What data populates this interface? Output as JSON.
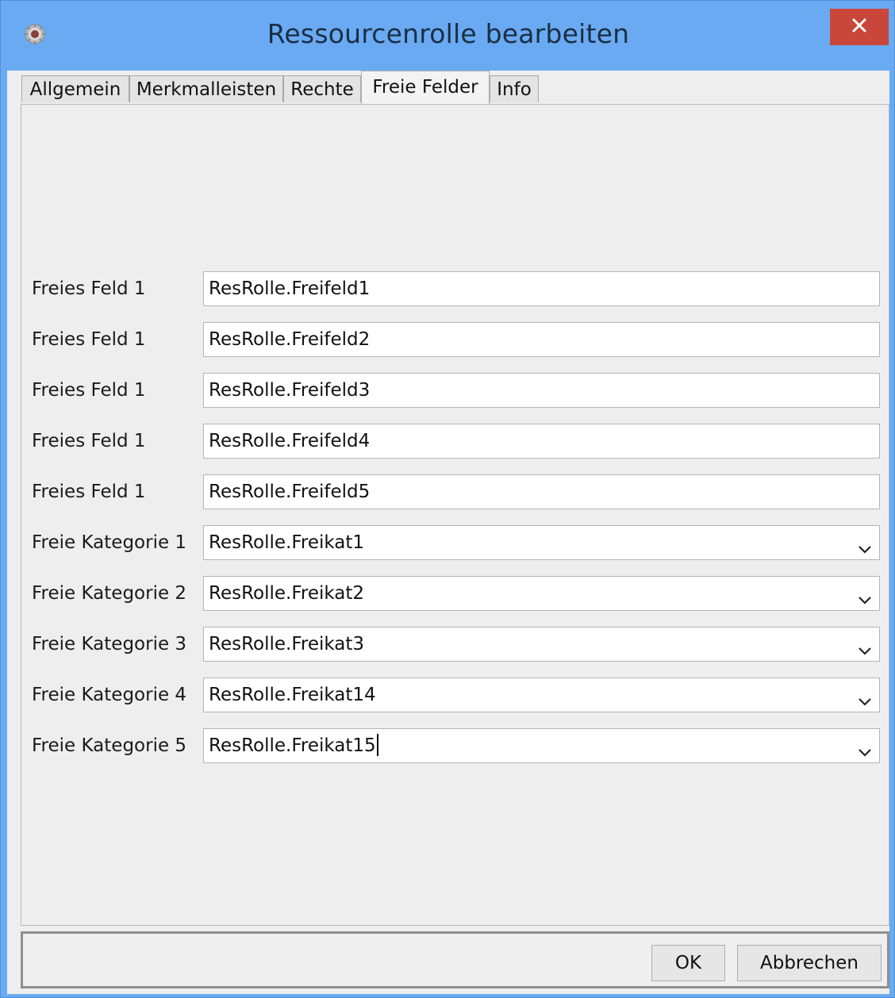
{
  "window": {
    "title": "Ressourcenrolle bearbeiten",
    "icon": "gear-globe-icon",
    "close_icon": "close-icon"
  },
  "tabs": [
    {
      "label": "Allgemein",
      "active": false
    },
    {
      "label": "Merkmalleisten",
      "active": false
    },
    {
      "label": "Rechte",
      "active": false
    },
    {
      "label": "Freie Felder",
      "active": true
    },
    {
      "label": "Info",
      "active": false
    }
  ],
  "free_fields": [
    {
      "label": "Freies Feld 1",
      "value": "ResRolle.Freifeld1"
    },
    {
      "label": "Freies Feld 1",
      "value": "ResRolle.Freifeld2"
    },
    {
      "label": "Freies Feld 1",
      "value": "ResRolle.Freifeld3"
    },
    {
      "label": "Freies Feld 1",
      "value": "ResRolle.Freifeld4"
    },
    {
      "label": "Freies Feld 1",
      "value": "ResRolle.Freifeld5"
    }
  ],
  "free_categories": [
    {
      "label": "Freie Kategorie 1",
      "value": "ResRolle.Freikat1"
    },
    {
      "label": "Freie Kategorie 2",
      "value": "ResRolle.Freikat2"
    },
    {
      "label": "Freie Kategorie 3",
      "value": "ResRolle.Freikat3"
    },
    {
      "label": "Freie Kategorie 4",
      "value": "ResRolle.Freikat14"
    },
    {
      "label": "Freie Kategorie 5",
      "value": "ResRolle.Freikat15"
    }
  ],
  "buttons": {
    "ok_label": "OK",
    "cancel_label": "Abbrechen"
  },
  "colors": {
    "titlebar": "#69aaf2",
    "close_button": "#c8463a",
    "panel": "#eeeeee"
  }
}
